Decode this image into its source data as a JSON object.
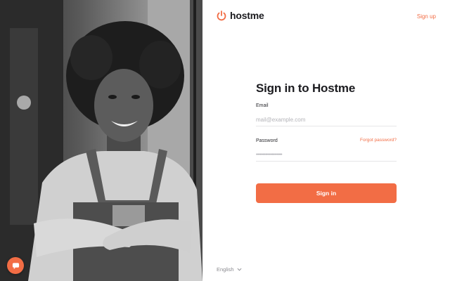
{
  "brand": {
    "name": "hostme",
    "accent": "#f26d45"
  },
  "header": {
    "signup_label": "Sign up"
  },
  "form": {
    "title": "Sign in to Hostme",
    "email_label": "Email",
    "email_placeholder": "mail@example.com",
    "email_value": "",
    "password_label": "Password",
    "forgot_label": "Forgot password?",
    "password_mask": "••••••••••••••••••••",
    "signin_label": "Sign in"
  },
  "footer": {
    "language": "English"
  },
  "icons": {
    "logo": "power-icon",
    "chat": "chat-icon",
    "language_toggle": "chevron-down-icon"
  }
}
